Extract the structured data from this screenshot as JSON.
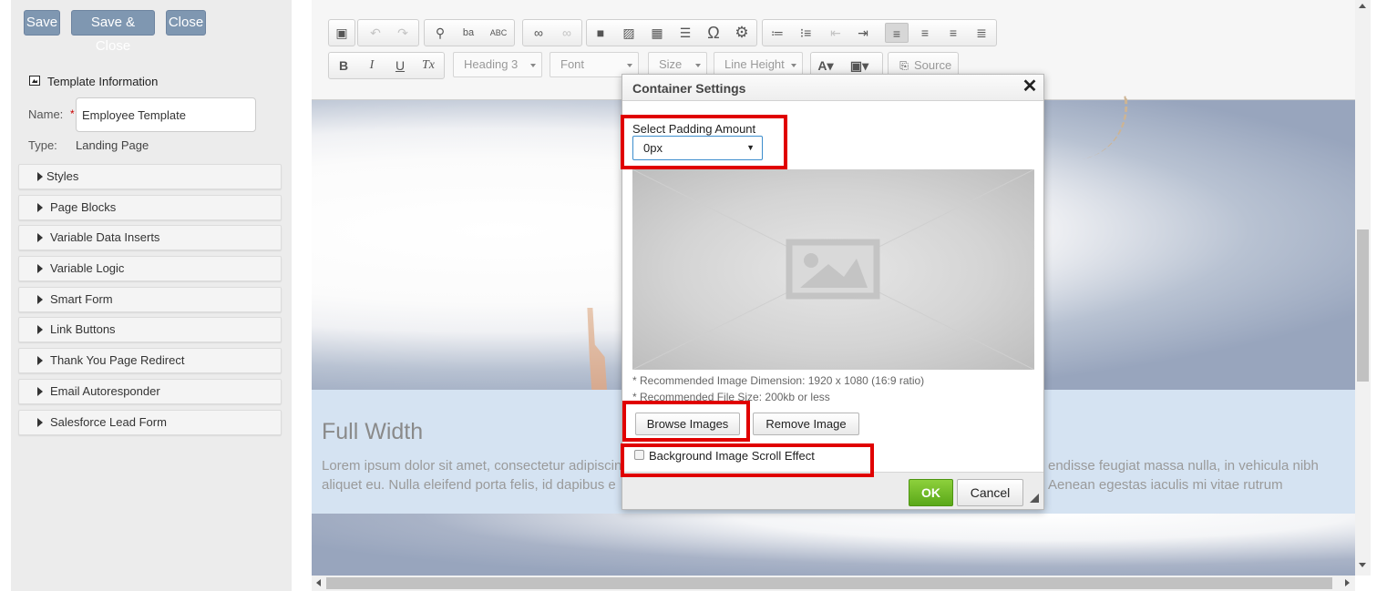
{
  "actions": {
    "save": "Save",
    "save_close": "Save & Close",
    "close": "Close"
  },
  "template_info": {
    "title": "Template Information",
    "name_label": "Name:",
    "name_value": "Employee Template",
    "type_label": "Type:",
    "type_value": "Landing Page"
  },
  "accordion": [
    "Styles",
    "Page Blocks",
    "Variable Data Inserts",
    "Variable Logic",
    "Smart Form",
    "Link Buttons",
    "Thank You Page Redirect",
    "Email Autoresponder",
    "Salesforce Lead Form"
  ],
  "toolbar": {
    "format": "Heading 3",
    "font": "Font",
    "size": "Size",
    "line_height": "Line Height",
    "source": "Source",
    "icons": [
      "paste-icon",
      "undo-icon",
      "redo-icon",
      "find-icon",
      "replace-icon",
      "spellcheck-icon",
      "link-icon",
      "unlink-icon",
      "video-icon",
      "image-icon",
      "table-icon",
      "horizontal-rule-icon",
      "special-char-icon",
      "settings-icon",
      "numbered-list-icon",
      "bullet-list-icon",
      "outdent-icon",
      "indent-icon",
      "align-left-icon",
      "align-center-icon",
      "align-right-icon",
      "justify-icon",
      "bold-icon",
      "italic-icon",
      "underline-icon",
      "remove-format-icon",
      "text-color-icon",
      "background-color-icon"
    ]
  },
  "content": {
    "section_title": "Full Width",
    "lorem_1": "Lorem ipsum dolor sit amet, consectetur adipiscing",
    "lorem_1b": "endisse feugiat massa nulla, in vehicula nibh",
    "lorem_2": "aliquet eu. Nulla eleifend porta felis, id dapibus e",
    "lorem_2b": "Aenean egestas iaculis mi vitae rutrum"
  },
  "dialog": {
    "title": "Container Settings",
    "close": "✕",
    "padding_label": "Select Padding Amount",
    "padding_value": "0px",
    "caret": "▼",
    "rec_dimension": "* Recommended Image Dimension: 1920 x 1080 (16:9 ratio)",
    "rec_size": "* Recommended File Size: 200kb or less",
    "browse": "Browse Images",
    "remove": "Remove Image",
    "scroll_effect_label": "Background Image Scroll Effect",
    "scroll_effect_checked": false,
    "ok": "OK",
    "cancel": "Cancel"
  },
  "colors": {
    "action_button": "#7f97b1",
    "ok_button": "#6cb823",
    "highlight": "#e00000",
    "band": "#d5e3f2"
  }
}
